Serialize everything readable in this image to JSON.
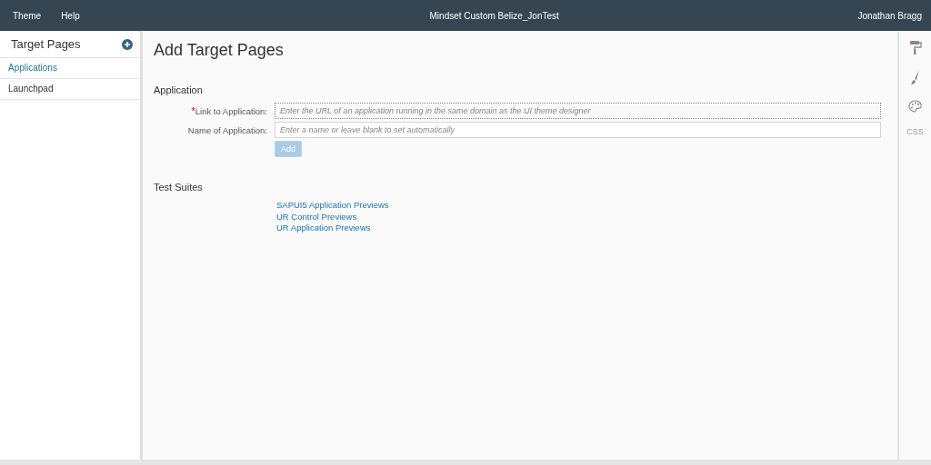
{
  "header": {
    "menu": [
      "Theme",
      "Help"
    ],
    "title": "Mindset Custom Belize_JonTest",
    "user": "Jonathan Bragg"
  },
  "sidebar": {
    "title": "Target Pages",
    "items": [
      {
        "label": "Applications",
        "selected": true
      },
      {
        "label": "Launchpad",
        "selected": false
      }
    ]
  },
  "page_title": "Add Target Pages",
  "application": {
    "heading": "Application",
    "fields": [
      {
        "required_mark": "*",
        "label": "Link to Application:",
        "placeholder": "Enter the URL of an application running in the same domain as the UI theme designer",
        "focused": true
      },
      {
        "label": "Name of Application:",
        "placeholder": "Enter a name or leave blank to set automatically",
        "focused": false
      }
    ],
    "button": {
      "label": "Add",
      "disabled": true
    }
  },
  "test_suites": {
    "heading": "Test Suites",
    "links": [
      "SAPUI5 Application Previews",
      "UR Control Previews",
      "UR Application Previews"
    ]
  },
  "toolbar": {
    "css_label": "CSS"
  }
}
